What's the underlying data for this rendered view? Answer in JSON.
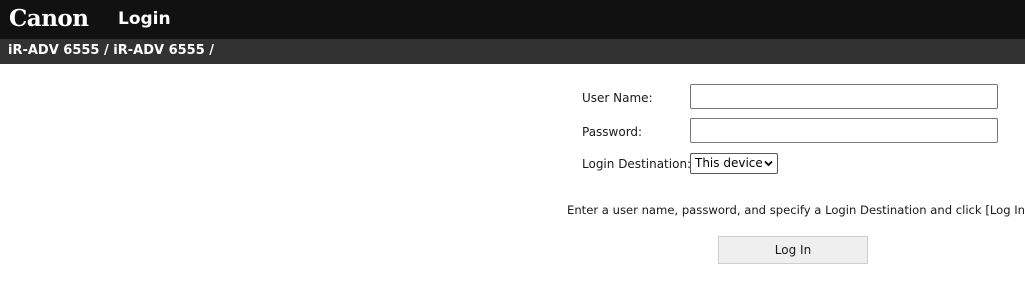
{
  "header": {
    "logo_text": "Canon",
    "page_title": "Login"
  },
  "breadcrumb": "iR-ADV 6555 / iR-ADV 6555 /",
  "form": {
    "username_label": "User Name:",
    "username_value": "",
    "password_label": "Password:",
    "password_value": "",
    "destination_label": "Login Destination:",
    "destination_selected": "This device",
    "instructions": "Enter a user name, password, and specify a Login Destination and click [Log In].",
    "login_button_label": "Log In"
  },
  "colors": {
    "header_bg": "#111111",
    "breadcrumb_bg": "#323232",
    "button_bg": "#efefef"
  }
}
